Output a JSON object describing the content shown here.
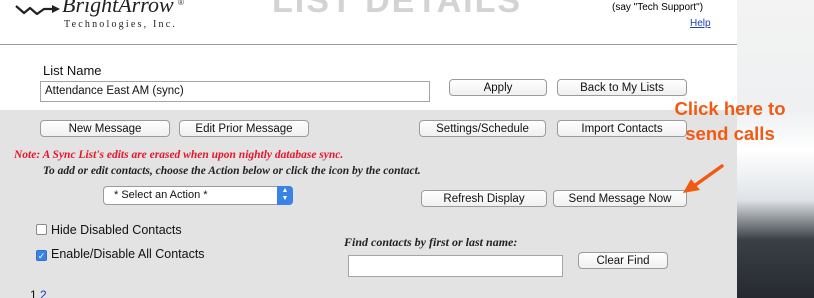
{
  "header": {
    "logo_text": "BrightArrow",
    "logo_registered": "®",
    "logo_subtitle": "Technologies, Inc.",
    "page_title": "LIST DETAILS",
    "support_text": "(say \"Tech Support\")",
    "help_link": "Help"
  },
  "form": {
    "list_name_label": "List Name",
    "list_name_value": "Attendance East AM (sync)",
    "apply_button": "Apply",
    "back_button": "Back to My Lists",
    "new_message_button": "New Message",
    "edit_prior_button": "Edit Prior Message",
    "settings_button": "Settings/Schedule",
    "import_button": "Import Contacts",
    "note": "Note: A Sync List's edits are erased when upon nightly database sync.",
    "instructions": "To add or edit contacts, choose the Action below or click the icon by the contact.",
    "action_select": "* Select an Action *",
    "refresh_button": "Refresh Display",
    "send_button": "Send Message Now",
    "hide_disabled_label": "Hide Disabled Contacts",
    "hide_disabled_checked": false,
    "enable_all_label": "Enable/Disable All Contacts",
    "enable_all_checked": true,
    "find_label": "Find contacts by first or last name:",
    "find_value": "",
    "clear_find_button": "Clear Find",
    "pages": [
      "1",
      "2"
    ]
  },
  "annotation": {
    "callout_line1": "Click here to",
    "callout_line2": "send calls",
    "color": "#f25a12"
  }
}
